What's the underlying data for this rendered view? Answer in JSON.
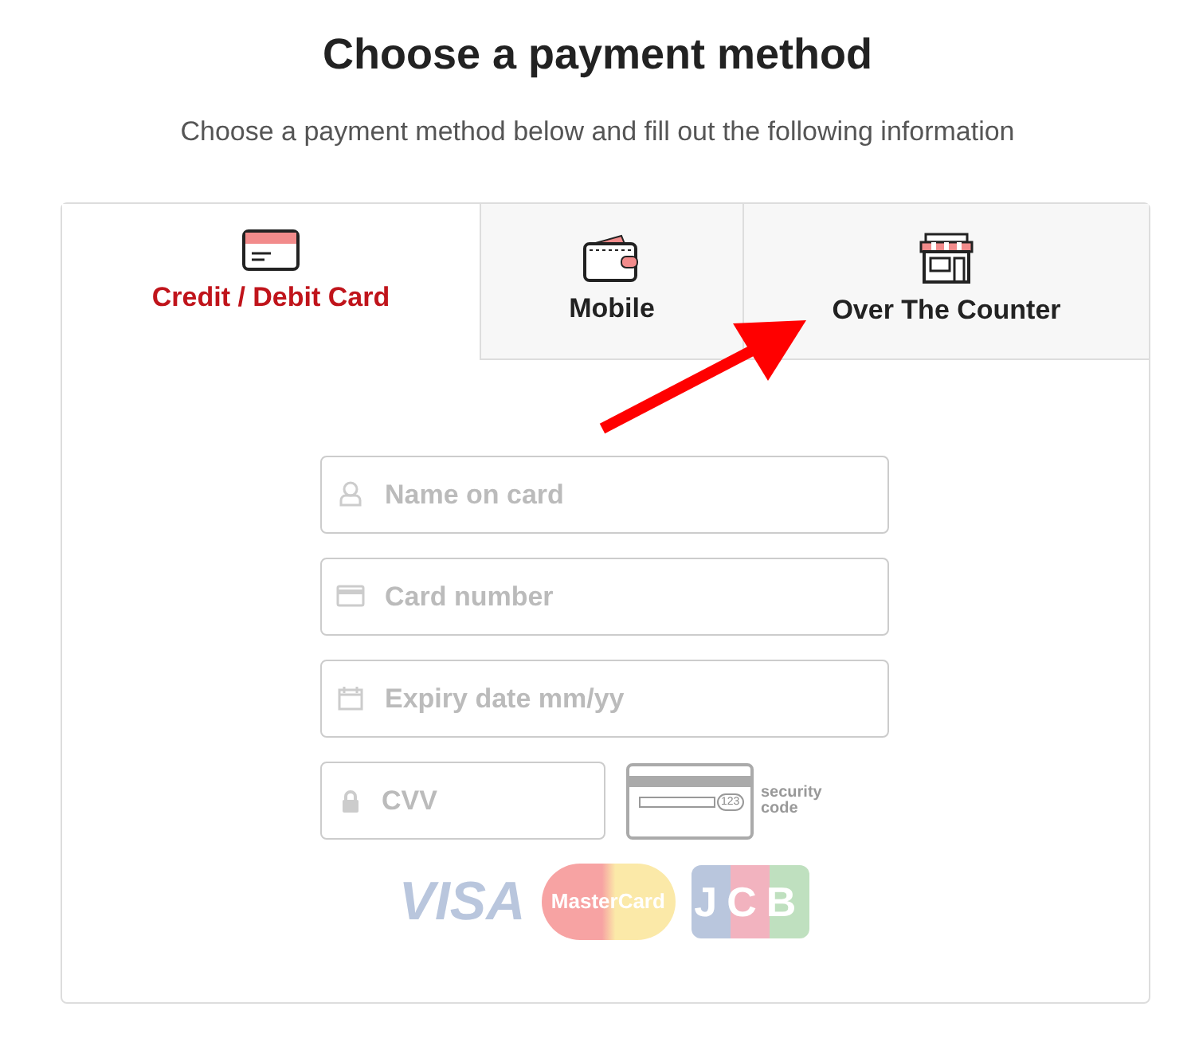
{
  "title": "Choose a payment method",
  "subtitle": "Choose a payment method below and fill out the following information",
  "tabs": [
    {
      "label": "Credit / Debit Card",
      "kind": "card",
      "selected": true
    },
    {
      "label": "Mobile",
      "kind": "wallet",
      "selected": false
    },
    {
      "label": "Over The Counter",
      "kind": "store",
      "selected": false
    }
  ],
  "fields": [
    {
      "placeholder": "Name on card",
      "kind": "person"
    },
    {
      "placeholder": "Card number",
      "kind": "card"
    },
    {
      "placeholder": "Expiry date mm/yy",
      "kind": "calendar"
    }
  ],
  "cvv": {
    "placeholder": "CVV"
  },
  "security_card": {
    "number": "123",
    "label": "security code"
  },
  "card_logos": [
    {
      "text": "VISA",
      "kind": "visa"
    },
    {
      "text": "MasterCard",
      "kind": "mastercard"
    },
    {
      "text": "JCB",
      "kind": "jcb"
    }
  ]
}
